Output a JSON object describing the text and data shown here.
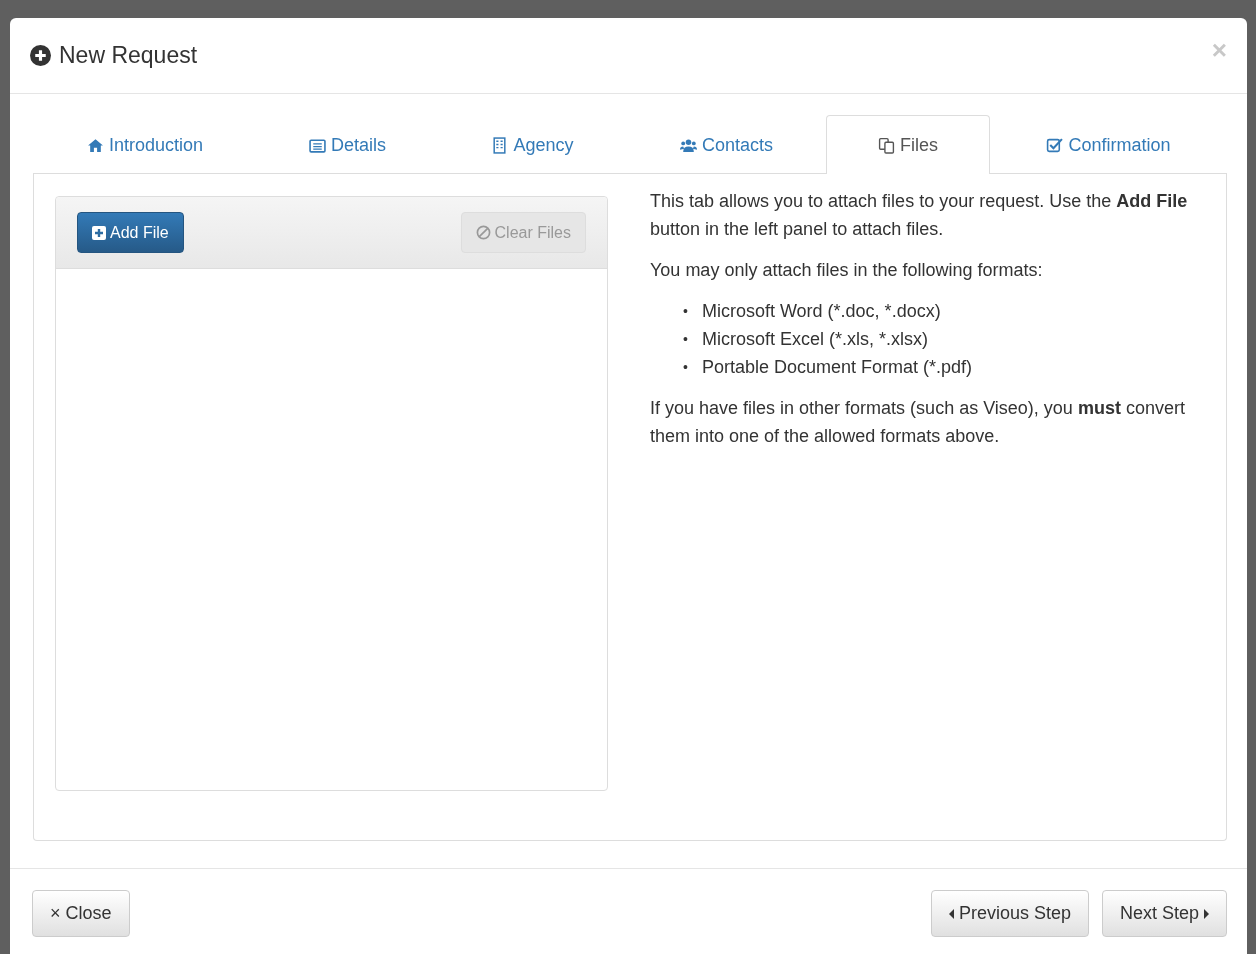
{
  "modal": {
    "title": "New Request",
    "close_glyph": "×"
  },
  "tabs": [
    {
      "label": "Introduction",
      "selected": false
    },
    {
      "label": "Details",
      "selected": false
    },
    {
      "label": "Agency",
      "selected": false
    },
    {
      "label": "Contacts",
      "selected": false
    },
    {
      "label": "Files",
      "selected": true
    },
    {
      "label": "Confirmation",
      "selected": false
    }
  ],
  "file_panel": {
    "add_button": {
      "label": "Add File",
      "disabled": false
    },
    "clear_button": {
      "label": "Clear Files",
      "disabled": true
    }
  },
  "help": {
    "paragraphs": [
      "This tab allows you to attach files to your request. Use the **Add File** button in the left panel to attach files.",
      "You may only attach files in the following formats:"
    ],
    "formats": [
      {
        "bullet": "•",
        "text": "Microsoft Word (*.doc, *.docx)"
      },
      {
        "bullet": "•",
        "text": "Microsoft Excel (*.xls, *.xlsx)"
      },
      {
        "bullet": "•",
        "text": "Portable Document Format (*.pdf)"
      }
    ],
    "note": "If you have files in other formats (such as Viseo), you **must** convert them into one of the allowed formats above."
  },
  "footer": {
    "close_button": "× Close",
    "previous_button": "Previous Step",
    "next_button": "Next Step"
  }
}
